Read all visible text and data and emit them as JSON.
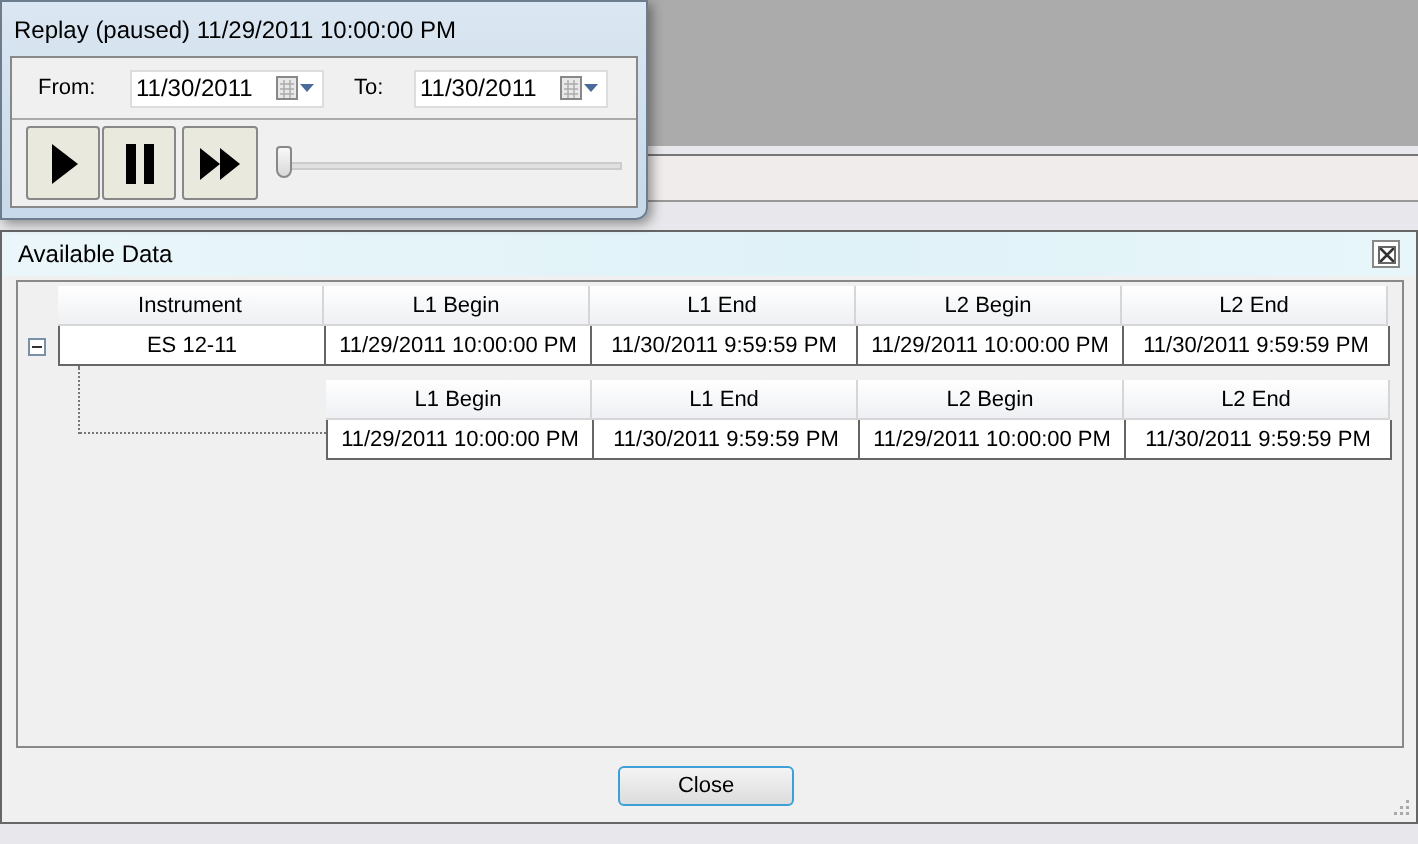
{
  "replay_window": {
    "title": "Replay (paused) 11/29/2011 10:00:00 PM",
    "from_label": "From:",
    "from_date": "11/30/2011",
    "to_label": "To:",
    "to_date": "11/30/2011",
    "slider": {
      "level": 0
    }
  },
  "data_window": {
    "title": "Available Data",
    "master_table": {
      "columns": [
        "Instrument",
        "L1 Begin",
        "L1 End",
        "L2 Begin",
        "L2 End"
      ],
      "rows": [
        {
          "expanded": true,
          "cells": [
            "ES 12-11",
            "11/29/2011 10:00:00 PM",
            "11/30/2011 9:59:59 PM",
            "11/29/2011 10:00:00 PM",
            "11/30/2011 9:59:59 PM"
          ],
          "detail_table": {
            "columns": [
              "L1 Begin",
              "L1 End",
              "L2 Begin",
              "L2 End"
            ],
            "rows": [
              [
                "11/29/2011 10:00:00 PM",
                "11/30/2011 9:59:59 PM",
                "11/29/2011 10:00:00 PM",
                "11/30/2011 9:59:59 PM"
              ]
            ]
          }
        }
      ]
    },
    "close_button": "Close"
  }
}
